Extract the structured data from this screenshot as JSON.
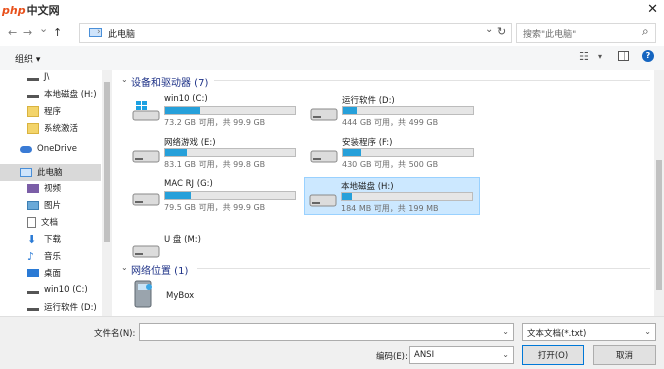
{
  "watermark": {
    "latin": "php",
    "cn": "中文网"
  },
  "window": {
    "close_glyph": "✕"
  },
  "nav": {
    "back_glyph": "←",
    "forward_glyph": "→",
    "dropdown_glyph": "⌄",
    "up_glyph": "↑",
    "address": "此电脑",
    "address_arrow": "⌄",
    "refresh_glyph": "↻",
    "search_placeholder": "搜索\"此电脑\"",
    "search_glyph": "⌕"
  },
  "toolbar": {
    "organize_label": "组织 ▾",
    "view_glyph": "☷",
    "view_arrow": "▾",
    "help_glyph": "?"
  },
  "sidebar": {
    "items": [
      {
        "label": "J\\",
        "icon": "drive-icon"
      },
      {
        "label": "本地磁盘 (H:)",
        "icon": "drive-icon"
      },
      {
        "label": "程序",
        "icon": "folder-icon"
      },
      {
        "label": "系统激活",
        "icon": "folder-icon"
      },
      {
        "label": "OneDrive",
        "icon": "cloud-icon"
      },
      {
        "label": "此电脑",
        "icon": "computer-icon"
      },
      {
        "label": "视频",
        "icon": "video-icon"
      },
      {
        "label": "图片",
        "icon": "picture-icon"
      },
      {
        "label": "文档",
        "icon": "document-icon"
      },
      {
        "label": "下载",
        "icon": "download-icon"
      },
      {
        "label": "音乐",
        "icon": "music-icon"
      },
      {
        "label": "桌面",
        "icon": "desktop-icon"
      },
      {
        "label": "win10 (C:)",
        "icon": "drive-icon"
      },
      {
        "label": "运行软件 (D:)",
        "icon": "drive-icon"
      }
    ]
  },
  "main": {
    "devices_header": "设备和驱动器 (7)",
    "network_header": "网络位置 (1)",
    "drives": [
      {
        "name": "win10 (C:)",
        "info": "73.2 GB 可用，共 99.9 GB",
        "used": 0.27
      },
      {
        "name": "运行软件 (D:)",
        "info": "444 GB 可用，共 499 GB",
        "used": 0.11
      },
      {
        "name": "网络游戏 (E:)",
        "info": "83.1 GB 可用，共 99.8 GB",
        "used": 0.17
      },
      {
        "name": "安装程序 (F:)",
        "info": "430 GB 可用，共 500 GB",
        "used": 0.14
      },
      {
        "name": "MAC RJ (G:)",
        "info": "79.5 GB 可用，共 99.9 GB",
        "used": 0.2
      },
      {
        "name": "本地磁盘 (H:)",
        "info": "184 MB 可用，共 199 MB",
        "used": 0.08
      },
      {
        "name": "U 盘 (M:)",
        "info": "",
        "used": null
      }
    ],
    "network": [
      {
        "name": "MyBox"
      }
    ]
  },
  "footer": {
    "filename_label": "文件名(N):",
    "filename_value": "",
    "filetype_value": "文本文档(*.txt)",
    "encoding_label": "编码(E):",
    "encoding_value": "ANSI",
    "open_label": "打开(O)",
    "cancel_label": "取消",
    "dropdown_glyph": "⌄"
  },
  "colors": {
    "accent": "#26a0da",
    "header_text": "#1e3287",
    "selection": "#cce8ff"
  }
}
